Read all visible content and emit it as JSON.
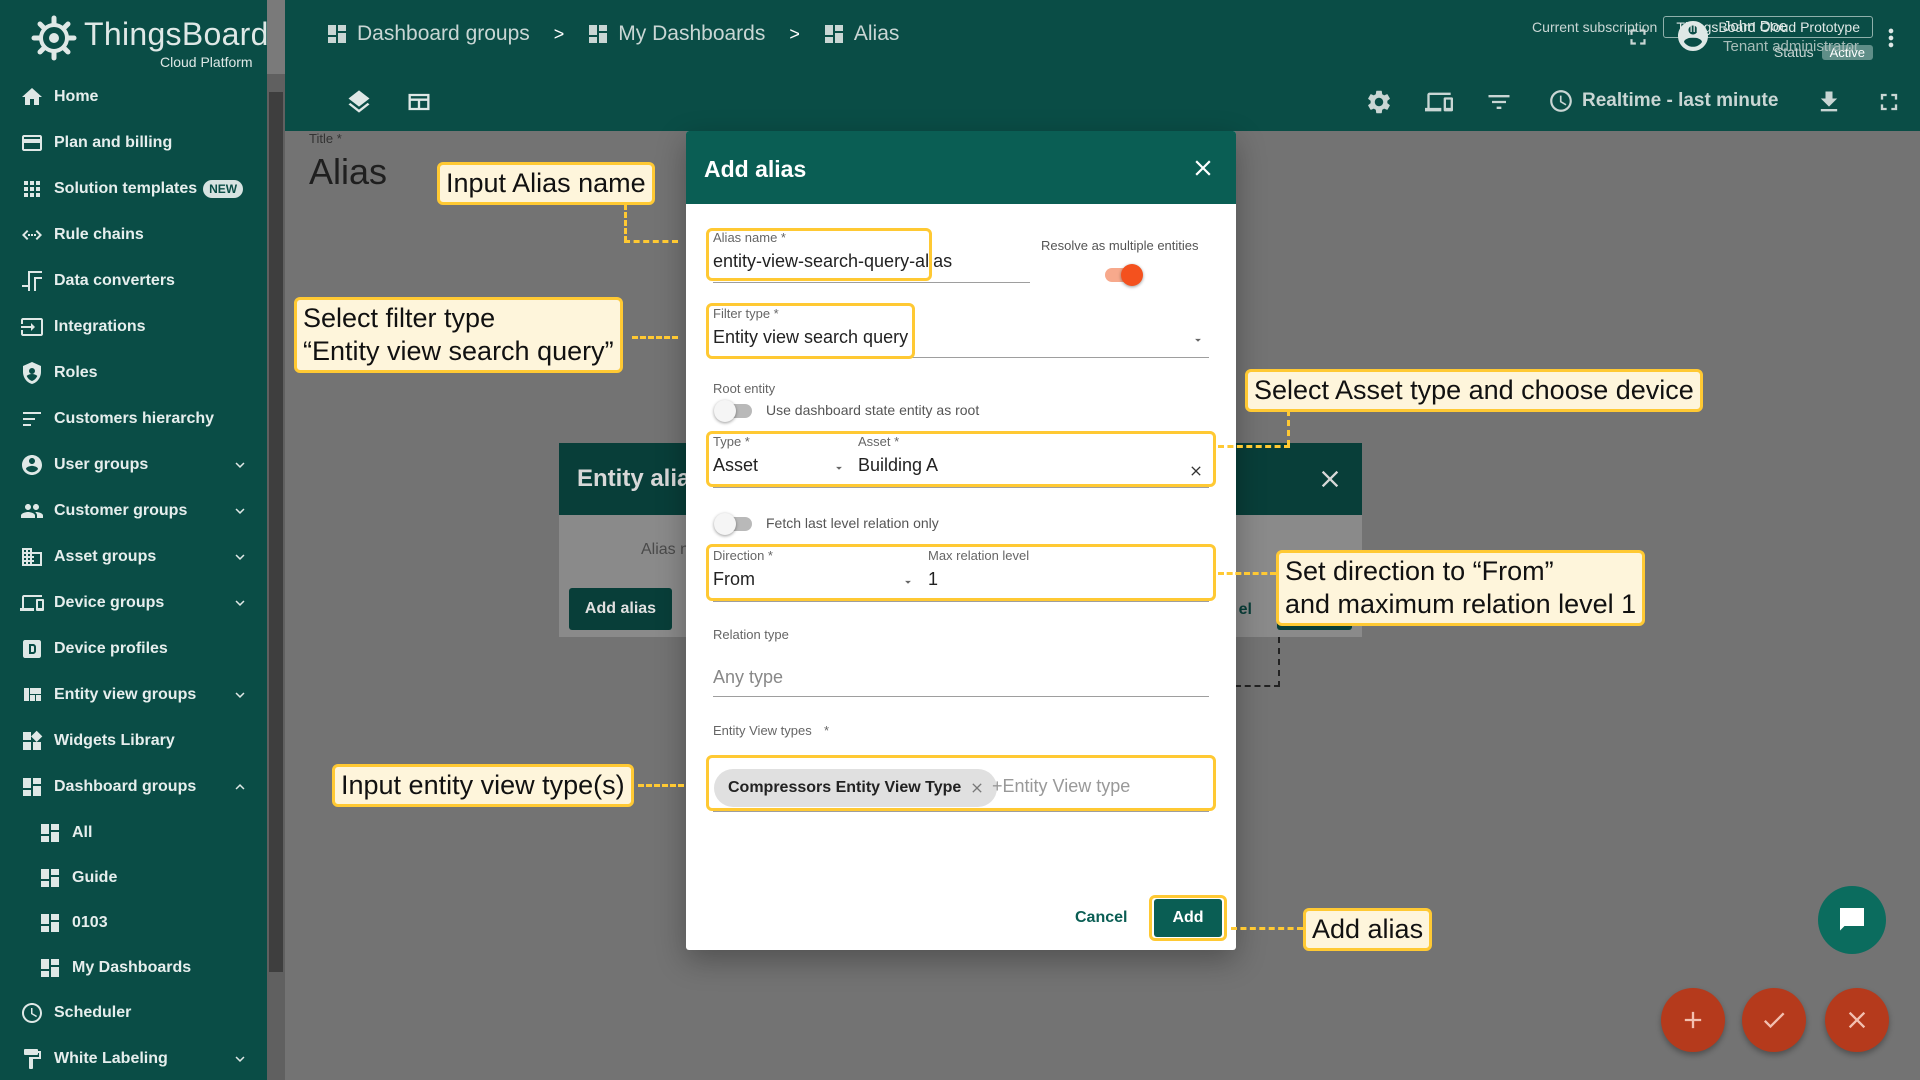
{
  "app": {
    "name": "ThingsBoard",
    "subtitle": "Cloud Platform"
  },
  "sidebar": {
    "items": [
      {
        "label": "Home",
        "icon": "home-icon"
      },
      {
        "label": "Plan and billing",
        "icon": "billing-icon"
      },
      {
        "label": "Solution templates",
        "icon": "apps-icon",
        "badge": "NEW"
      },
      {
        "label": "Rule chains",
        "icon": "rule-chain-icon"
      },
      {
        "label": "Data converters",
        "icon": "converter-icon"
      },
      {
        "label": "Integrations",
        "icon": "integration-icon"
      },
      {
        "label": "Roles",
        "icon": "shield-icon"
      },
      {
        "label": "Customers hierarchy",
        "icon": "hierarchy-icon"
      },
      {
        "label": "User groups",
        "icon": "account-circle-icon",
        "expandable": true
      },
      {
        "label": "Customer groups",
        "icon": "people-icon",
        "expandable": true
      },
      {
        "label": "Asset groups",
        "icon": "building-icon",
        "expandable": true
      },
      {
        "label": "Device groups",
        "icon": "devices-icon",
        "expandable": true
      },
      {
        "label": "Device profiles",
        "icon": "device-profile-icon"
      },
      {
        "label": "Entity view groups",
        "icon": "view-quilt-icon",
        "expandable": true
      },
      {
        "label": "Widgets Library",
        "icon": "widgets-icon"
      },
      {
        "label": "Dashboard groups",
        "icon": "dashboard-icon",
        "expanded": true
      },
      {
        "label": "All",
        "icon": "dashboard-icon",
        "sub": true
      },
      {
        "label": "Guide",
        "icon": "dashboard-icon",
        "sub": true
      },
      {
        "label": "0103",
        "icon": "dashboard-icon",
        "sub": true
      },
      {
        "label": "My Dashboards",
        "icon": "dashboard-icon",
        "sub": true
      },
      {
        "label": "Scheduler",
        "icon": "clock-icon"
      },
      {
        "label": "White Labeling",
        "icon": "format-paint-icon",
        "expandable": true
      }
    ]
  },
  "header": {
    "breadcrumbs": [
      "Dashboard groups",
      "My Dashboards",
      "Alias"
    ],
    "subscription_label": "Current subscription",
    "subscription_value": "ThingsBoard Cloud Prototype",
    "status_label": "Status",
    "status_value": "Active",
    "user_name": "John Doe",
    "user_role": "Tenant administrator",
    "realtime": "Realtime - last minute"
  },
  "dashboard": {
    "title_label": "Title *",
    "title": "Alias"
  },
  "entity_aliases_dialog": {
    "title": "Entity alias",
    "alias_col": "Alias n",
    "add_alias": "Add alias",
    "cancel_partial": "el"
  },
  "dialog": {
    "title": "Add alias",
    "alias_name_label": "Alias name *",
    "alias_name_value": "entity-view-search-query-alias",
    "resolve_multiple_label": "Resolve as multiple entities",
    "filter_type_label": "Filter type *",
    "filter_type_value": "Entity view search query",
    "root_entity_label": "Root entity",
    "use_dashboard_state_label": "Use dashboard state entity as root",
    "type_label": "Type *",
    "type_value": "Asset",
    "asset_label": "Asset *",
    "asset_value": "Building A",
    "fetch_last_level_label": "Fetch last level relation only",
    "direction_label": "Direction *",
    "direction_value": "From",
    "max_level_label": "Max relation level",
    "max_level_value": "1",
    "relation_type_label": "Relation type",
    "relation_type_placeholder": "Any type",
    "entity_view_types_label": "Entity View types",
    "entity_view_type_chip": "Compressors Entity View Type",
    "entity_view_type_placeholder": "+Entity View type",
    "cancel": "Cancel",
    "add": "Add"
  },
  "callouts": {
    "alias_name": "Input Alias name",
    "filter_type_line1": "Select filter type",
    "filter_type_line2": "“Entity view search query”",
    "asset_type": "Select Asset type and choose device",
    "direction_line1": "Set direction to “From”",
    "direction_line2": "and maximum relation level 1",
    "entity_view_type": "Input entity view type(s)",
    "add_alias": "Add alias"
  },
  "colors": {
    "primary": "#0a5e54",
    "sidebar": "#0a4d46",
    "highlight": "#ffc933",
    "callout_bg": "#fef5db",
    "toggle_on": "#f4511e",
    "fab": "#b53a1c"
  }
}
